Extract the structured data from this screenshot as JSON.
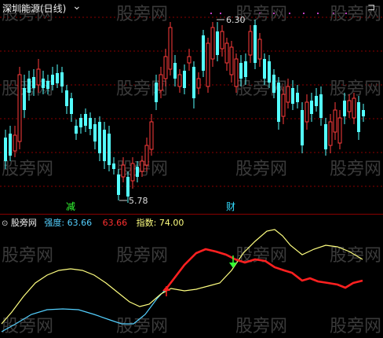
{
  "header": {
    "title": "深圳能源(日线)",
    "collapse_glyph": "⌄",
    "window_button": "⊐"
  },
  "price_chart": {
    "high_label": "6.30",
    "low_label": "5.78",
    "signal_jian": "减",
    "signal_cai": "财",
    "up_color": "#ff3b3b",
    "down_color": "#54ffff",
    "grid_color": "#8a0000"
  },
  "indicator": {
    "name": "股旁网",
    "strength_label": "强度:",
    "strength_value": "63.66",
    "strength2_value": "63.66",
    "index_label": "指数:",
    "index_value": "74.00",
    "cyan_color": "#54d0ff",
    "red_color": "#ff2020",
    "yellow_color": "#ffff80"
  },
  "watermark": "股旁网"
}
